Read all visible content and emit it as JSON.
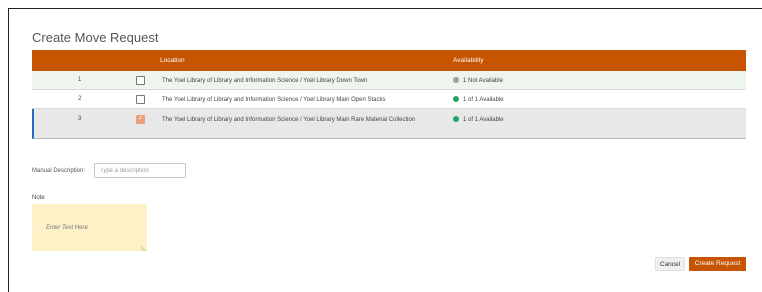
{
  "dialog": {
    "title": "Create Move Request"
  },
  "table": {
    "headers": {
      "location": "Location",
      "availability": "Availability"
    },
    "rows": [
      {
        "num": "1",
        "checked": false,
        "location": "The Yoel Library of Library and Information Science / Yoel Library Down Town",
        "availability": "1 Not Available",
        "status_color": "#9e9e9e"
      },
      {
        "num": "2",
        "checked": false,
        "location": "The Yoel Library of Library and Information Science / Yoel Library Main Open Stacks",
        "availability": "1 of 1 Available",
        "status_color": "#26a269"
      },
      {
        "num": "3",
        "checked": true,
        "location": "The Yoel Library of Library and Information Science / Yoel Library Main Rare Material Collection",
        "availability": "1 of 1 Available",
        "status_color": "#26a269"
      }
    ]
  },
  "manual_description": {
    "label": "Manual Description:",
    "placeholder": "Type a description",
    "value": ""
  },
  "note": {
    "label": "Note",
    "placeholder": "Enter Text Here"
  },
  "buttons": {
    "cancel": "Cancel",
    "create": "Create Request"
  },
  "colors": {
    "accent": "#c65400",
    "selected_row_marker": "#1e6fc2",
    "note_bg": "#fdf2c7"
  }
}
